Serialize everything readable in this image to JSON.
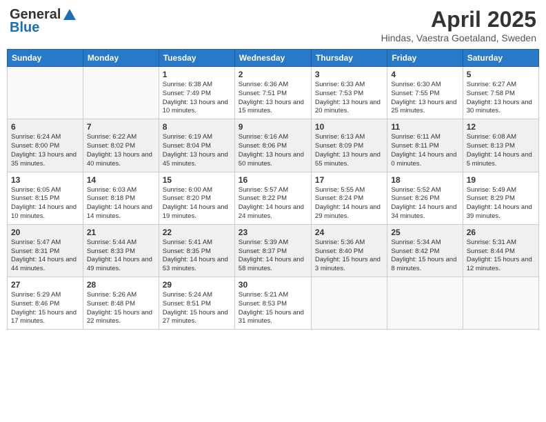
{
  "header": {
    "logo_general": "General",
    "logo_blue": "Blue",
    "title": "April 2025",
    "location": "Hindas, Vaestra Goetaland, Sweden"
  },
  "weekdays": [
    "Sunday",
    "Monday",
    "Tuesday",
    "Wednesday",
    "Thursday",
    "Friday",
    "Saturday"
  ],
  "weeks": [
    [
      {
        "day": "",
        "info": ""
      },
      {
        "day": "",
        "info": ""
      },
      {
        "day": "1",
        "info": "Sunrise: 6:38 AM\nSunset: 7:49 PM\nDaylight: 13 hours and 10 minutes."
      },
      {
        "day": "2",
        "info": "Sunrise: 6:36 AM\nSunset: 7:51 PM\nDaylight: 13 hours and 15 minutes."
      },
      {
        "day": "3",
        "info": "Sunrise: 6:33 AM\nSunset: 7:53 PM\nDaylight: 13 hours and 20 minutes."
      },
      {
        "day": "4",
        "info": "Sunrise: 6:30 AM\nSunset: 7:55 PM\nDaylight: 13 hours and 25 minutes."
      },
      {
        "day": "5",
        "info": "Sunrise: 6:27 AM\nSunset: 7:58 PM\nDaylight: 13 hours and 30 minutes."
      }
    ],
    [
      {
        "day": "6",
        "info": "Sunrise: 6:24 AM\nSunset: 8:00 PM\nDaylight: 13 hours and 35 minutes."
      },
      {
        "day": "7",
        "info": "Sunrise: 6:22 AM\nSunset: 8:02 PM\nDaylight: 13 hours and 40 minutes."
      },
      {
        "day": "8",
        "info": "Sunrise: 6:19 AM\nSunset: 8:04 PM\nDaylight: 13 hours and 45 minutes."
      },
      {
        "day": "9",
        "info": "Sunrise: 6:16 AM\nSunset: 8:06 PM\nDaylight: 13 hours and 50 minutes."
      },
      {
        "day": "10",
        "info": "Sunrise: 6:13 AM\nSunset: 8:09 PM\nDaylight: 13 hours and 55 minutes."
      },
      {
        "day": "11",
        "info": "Sunrise: 6:11 AM\nSunset: 8:11 PM\nDaylight: 14 hours and 0 minutes."
      },
      {
        "day": "12",
        "info": "Sunrise: 6:08 AM\nSunset: 8:13 PM\nDaylight: 14 hours and 5 minutes."
      }
    ],
    [
      {
        "day": "13",
        "info": "Sunrise: 6:05 AM\nSunset: 8:15 PM\nDaylight: 14 hours and 10 minutes."
      },
      {
        "day": "14",
        "info": "Sunrise: 6:03 AM\nSunset: 8:18 PM\nDaylight: 14 hours and 14 minutes."
      },
      {
        "day": "15",
        "info": "Sunrise: 6:00 AM\nSunset: 8:20 PM\nDaylight: 14 hours and 19 minutes."
      },
      {
        "day": "16",
        "info": "Sunrise: 5:57 AM\nSunset: 8:22 PM\nDaylight: 14 hours and 24 minutes."
      },
      {
        "day": "17",
        "info": "Sunrise: 5:55 AM\nSunset: 8:24 PM\nDaylight: 14 hours and 29 minutes."
      },
      {
        "day": "18",
        "info": "Sunrise: 5:52 AM\nSunset: 8:26 PM\nDaylight: 14 hours and 34 minutes."
      },
      {
        "day": "19",
        "info": "Sunrise: 5:49 AM\nSunset: 8:29 PM\nDaylight: 14 hours and 39 minutes."
      }
    ],
    [
      {
        "day": "20",
        "info": "Sunrise: 5:47 AM\nSunset: 8:31 PM\nDaylight: 14 hours and 44 minutes."
      },
      {
        "day": "21",
        "info": "Sunrise: 5:44 AM\nSunset: 8:33 PM\nDaylight: 14 hours and 49 minutes."
      },
      {
        "day": "22",
        "info": "Sunrise: 5:41 AM\nSunset: 8:35 PM\nDaylight: 14 hours and 53 minutes."
      },
      {
        "day": "23",
        "info": "Sunrise: 5:39 AM\nSunset: 8:37 PM\nDaylight: 14 hours and 58 minutes."
      },
      {
        "day": "24",
        "info": "Sunrise: 5:36 AM\nSunset: 8:40 PM\nDaylight: 15 hours and 3 minutes."
      },
      {
        "day": "25",
        "info": "Sunrise: 5:34 AM\nSunset: 8:42 PM\nDaylight: 15 hours and 8 minutes."
      },
      {
        "day": "26",
        "info": "Sunrise: 5:31 AM\nSunset: 8:44 PM\nDaylight: 15 hours and 12 minutes."
      }
    ],
    [
      {
        "day": "27",
        "info": "Sunrise: 5:29 AM\nSunset: 8:46 PM\nDaylight: 15 hours and 17 minutes."
      },
      {
        "day": "28",
        "info": "Sunrise: 5:26 AM\nSunset: 8:48 PM\nDaylight: 15 hours and 22 minutes."
      },
      {
        "day": "29",
        "info": "Sunrise: 5:24 AM\nSunset: 8:51 PM\nDaylight: 15 hours and 27 minutes."
      },
      {
        "day": "30",
        "info": "Sunrise: 5:21 AM\nSunset: 8:53 PM\nDaylight: 15 hours and 31 minutes."
      },
      {
        "day": "",
        "info": ""
      },
      {
        "day": "",
        "info": ""
      },
      {
        "day": "",
        "info": ""
      }
    ]
  ]
}
